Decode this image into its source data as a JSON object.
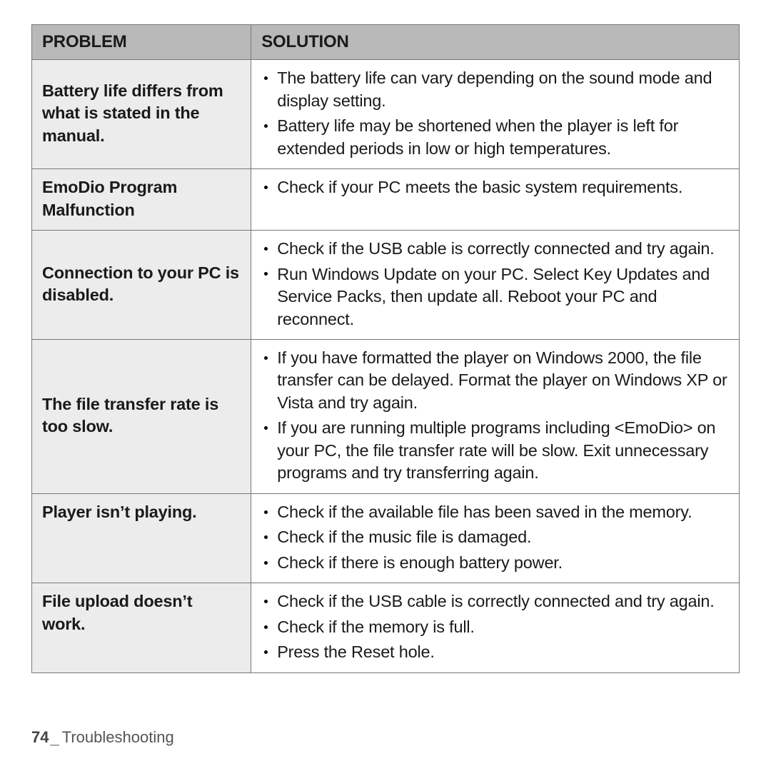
{
  "header": {
    "problem_label": "PROBLEM",
    "solution_label": "SOLUTION"
  },
  "rows": {
    "r0": {
      "problem": "Battery life differs from what is stated in the manual.",
      "solutions": {
        "s0": "The battery life can vary depending on the sound mode and display setting.",
        "s1": "Battery life may be shortened when the player is left for extended periods in low or high temperatures."
      }
    },
    "r1": {
      "problem": "EmoDio Program Malfunction",
      "solutions": {
        "s0": "Check if your PC meets the basic system requirements."
      }
    },
    "r2": {
      "problem": "Connection to your PC is disabled.",
      "solutions": {
        "s0": "Check if the USB cable is correctly connected and try again.",
        "s1": "Run Windows Update on your PC. Select Key Updates and Service Packs, then update all. Reboot your PC and reconnect."
      }
    },
    "r3": {
      "problem": "The file transfer rate is too slow.",
      "solutions": {
        "s0": "If you have formatted the player on Windows 2000, the file transfer can be delayed. Format the player on Windows XP or Vista and try again.",
        "s1": "If you are running multiple programs including <EmoDio> on your PC, the file transfer rate will be slow. Exit unnecessary programs and try transferring again."
      }
    },
    "r4": {
      "problem": "Player isn’t playing.",
      "solutions": {
        "s0": "Check if the available file has been saved in the memory.",
        "s1": "Check if the music file is damaged.",
        "s2": "Check if there is enough battery power."
      }
    },
    "r5": {
      "problem": "File upload doesn’t work.",
      "solutions": {
        "s0": "Check if the USB cable is correctly connected and try again.",
        "s1": "Check if the memory is full.",
        "s2": "Press the Reset hole."
      }
    }
  },
  "footer": {
    "page_number": "74",
    "section": "Troubleshooting"
  }
}
